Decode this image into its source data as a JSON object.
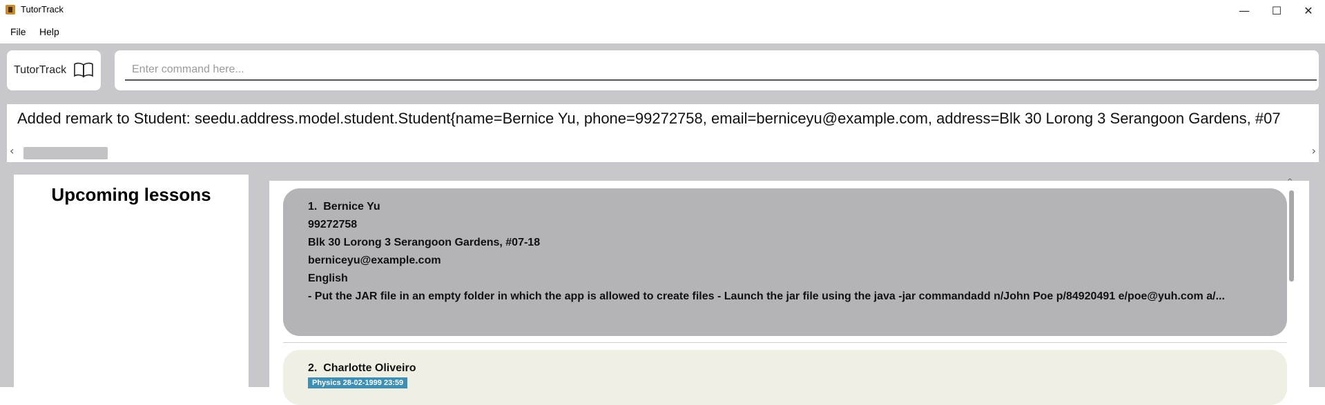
{
  "window": {
    "title": "TutorTrack",
    "minimize_glyph": "—",
    "maximize_glyph": "☐",
    "close_glyph": "✕"
  },
  "menu": {
    "items": [
      {
        "label": "File"
      },
      {
        "label": "Help"
      }
    ]
  },
  "brand": {
    "label": "TutorTrack",
    "icon": "book-icon"
  },
  "command": {
    "placeholder": "Enter command here..."
  },
  "result": {
    "text": "Added remark to Student: seedu.address.model.student.Student{name=Bernice Yu, phone=99272758, email=berniceyu@example.com, address=Blk 30 Lorong 3 Serangoon Gardens, #07"
  },
  "lessons": {
    "title": "Upcoming lessons"
  },
  "students": [
    {
      "index": "1.",
      "name": "Bernice Yu",
      "phone": "99272758",
      "address": "Blk 30 Lorong 3 Serangoon Gardens, #07-18",
      "email": "berniceyu@example.com",
      "subject": "English",
      "remark": "- Put the JAR file in an empty folder in which the app is allowed to create files - Launch the jar file using the java -jar commandadd n/John Poe p/84920491 e/poe@yuh.com a/..."
    },
    {
      "index": "2.",
      "name": "Charlotte Oliveiro",
      "tag": "Physics 28-02-1999 23:59"
    }
  ],
  "colors": {
    "card_selected": "#b3b3b8",
    "card_unselected": "#f0efe3",
    "tag": "#3f8fb5",
    "workspace": "#c8c8cc"
  }
}
